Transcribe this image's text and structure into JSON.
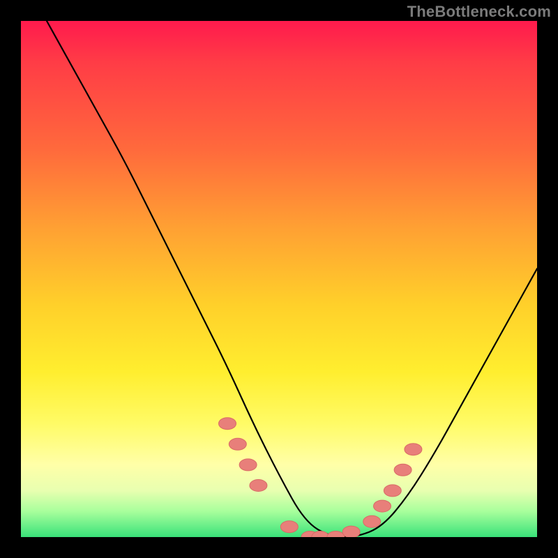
{
  "watermark": "TheBottleneck.com",
  "colors": {
    "curve_stroke": "#000000",
    "marker_fill": "#e87f7a",
    "marker_stroke": "#d96b66",
    "background": "#000000"
  },
  "chart_data": {
    "type": "line",
    "title": "",
    "xlabel": "",
    "ylabel": "",
    "xlim": [
      0,
      100
    ],
    "ylim": [
      0,
      100
    ],
    "grid": false,
    "legend": false,
    "series": [
      {
        "name": "curve",
        "x": [
          5,
          10,
          15,
          20,
          25,
          30,
          35,
          40,
          45,
          50,
          55,
          60,
          65,
          70,
          75,
          80,
          85,
          90,
          95,
          100
        ],
        "y": [
          100,
          91,
          82,
          73,
          63,
          53,
          43,
          33,
          22,
          12,
          3,
          0,
          0,
          2,
          8,
          16,
          25,
          34,
          43,
          52
        ]
      }
    ],
    "markers": {
      "name": "highlighted-points",
      "x": [
        40,
        42,
        44,
        46,
        52,
        56,
        58,
        61,
        64,
        68,
        70,
        72,
        74,
        76
      ],
      "y": [
        22,
        18,
        14,
        10,
        2,
        0,
        0,
        0,
        1,
        3,
        6,
        9,
        13,
        17
      ]
    }
  }
}
